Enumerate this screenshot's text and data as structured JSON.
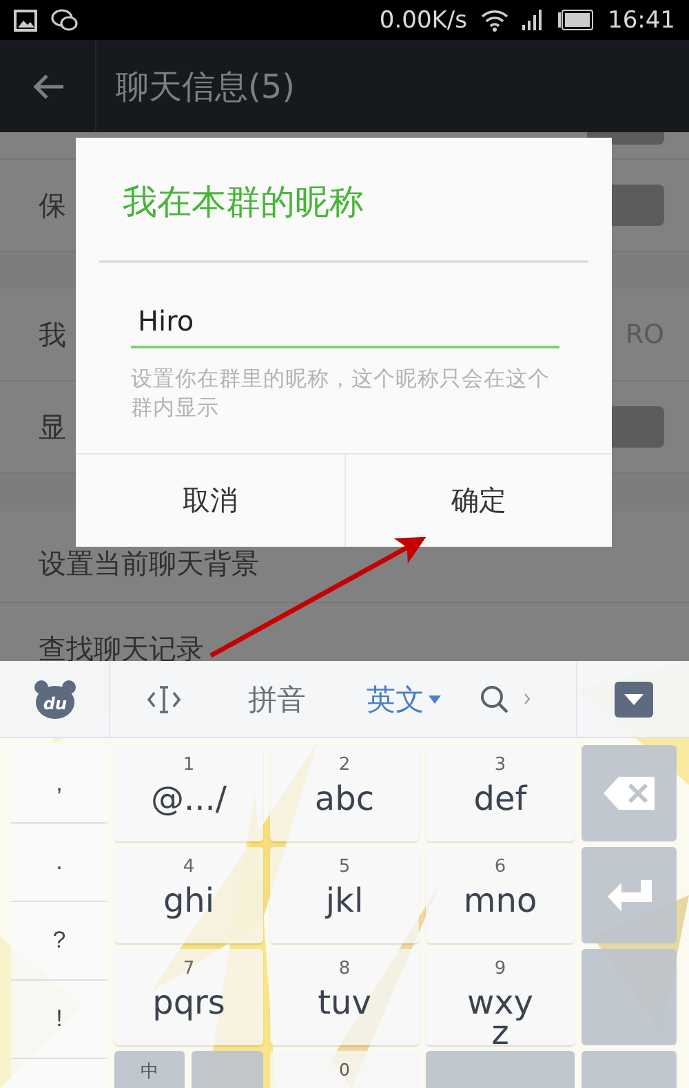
{
  "status_bar": {
    "net_speed": "0.00K/s",
    "time": "16:41"
  },
  "app_bar": {
    "title": "聊天信息(5)"
  },
  "sections": [
    [
      {
        "kind": "toggle",
        "on": false
      },
      {
        "kind": "toggle",
        "label": "保",
        "on": false
      }
    ],
    [
      {
        "kind": "value",
        "label": "我",
        "value": "RO"
      },
      {
        "kind": "toggle",
        "label": "显",
        "on": false
      }
    ],
    [
      {
        "kind": "link",
        "label": "设置当前聊天背景"
      },
      {
        "kind": "link",
        "label": "查找聊天记录"
      }
    ]
  ],
  "dialog": {
    "title": "我在本群的昵称",
    "input": {
      "value": "Hiro"
    },
    "hint": "设置你在群里的昵称，这个昵称只会在这个群内显示",
    "buttons": [
      "取消",
      "确定"
    ]
  },
  "keyboard": {
    "logo": "du",
    "modes": [
      {
        "label": "拼音",
        "selected": false
      },
      {
        "label": "英文",
        "selected": true
      }
    ],
    "side_keys": [
      ",",
      ".",
      "?",
      "!"
    ],
    "keys": [
      {
        "number": "1",
        "letters": "@.../"
      },
      {
        "number": "2",
        "letters": "abc"
      },
      {
        "number": "3",
        "letters": "def"
      },
      {
        "number": "4",
        "letters": "ghi"
      },
      {
        "number": "5",
        "letters": "jkl"
      },
      {
        "number": "6",
        "letters": "mno"
      },
      {
        "number": "7",
        "letters": "pqrs"
      },
      {
        "number": "8",
        "letters": "tuv"
      },
      {
        "number": "9",
        "letters": "wxyz"
      }
    ],
    "right_keys": [
      {
        "kind": "backspace"
      },
      {
        "kind": "enter"
      },
      {
        "kind": "blank"
      }
    ],
    "bottom_keys": [
      {
        "kind": "function",
        "label": "中"
      },
      {
        "kind": "function"
      },
      {
        "kind": "digit",
        "label": "0"
      },
      {
        "kind": "function"
      },
      {
        "kind": "function"
      }
    ]
  }
}
